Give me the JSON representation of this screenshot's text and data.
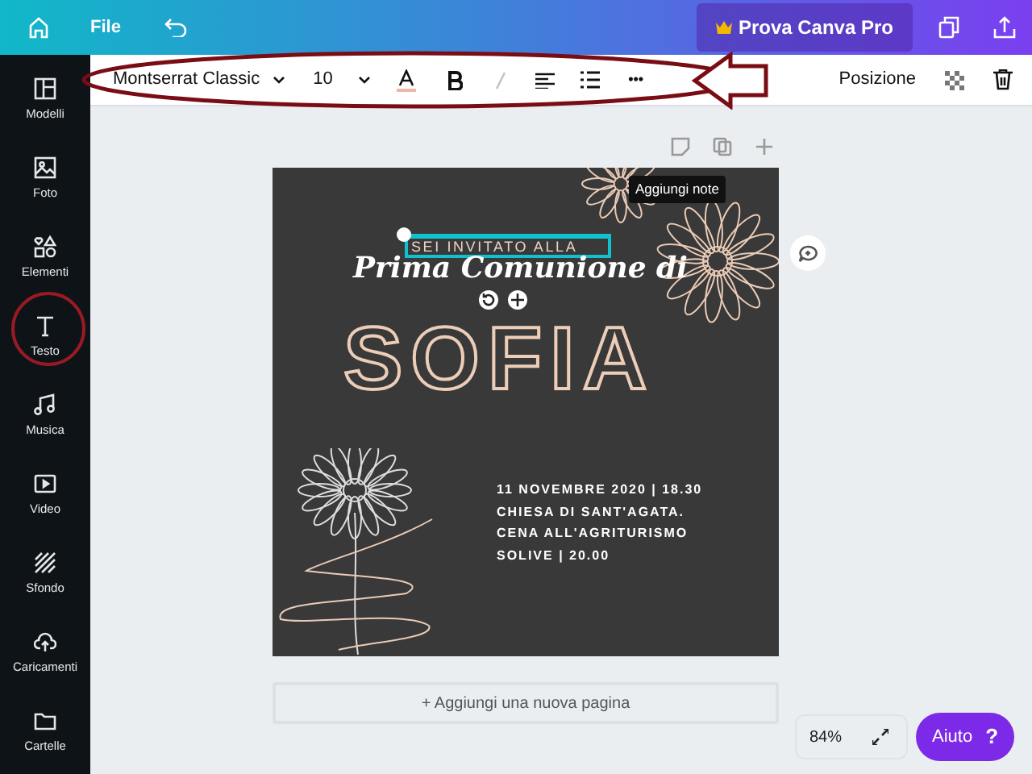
{
  "topbar": {
    "file": "File",
    "pro_button": "Prova Canva Pro"
  },
  "sidebar": {
    "items": [
      {
        "label": "Modelli"
      },
      {
        "label": "Foto"
      },
      {
        "label": "Elementi"
      },
      {
        "label": "Testo"
      },
      {
        "label": "Musica"
      },
      {
        "label": "Video"
      },
      {
        "label": "Sfondo"
      },
      {
        "label": "Caricamenti"
      },
      {
        "label": "Cartelle"
      }
    ]
  },
  "toolbar": {
    "font": "Montserrat Classic",
    "size": "10",
    "italic_disabled": true,
    "position": "Posizione",
    "more": "•••"
  },
  "page": {
    "tooltip": "Aggiungi note",
    "subtitle": "SEI INVITATO ALLA",
    "script_title": "Prima Comunione di",
    "name": "SOFIA",
    "details": [
      "11 NOVEMBRE 2020 | 18.30",
      "CHIESA DI SANT'AGATA.",
      "CENA ALL'AGRITURISMO",
      "SOLIVE | 20.00"
    ]
  },
  "add_page": "+ Aggiungi una nuova pagina",
  "zoom": "84%",
  "help": {
    "label": "Aiuto",
    "mark": "?"
  }
}
